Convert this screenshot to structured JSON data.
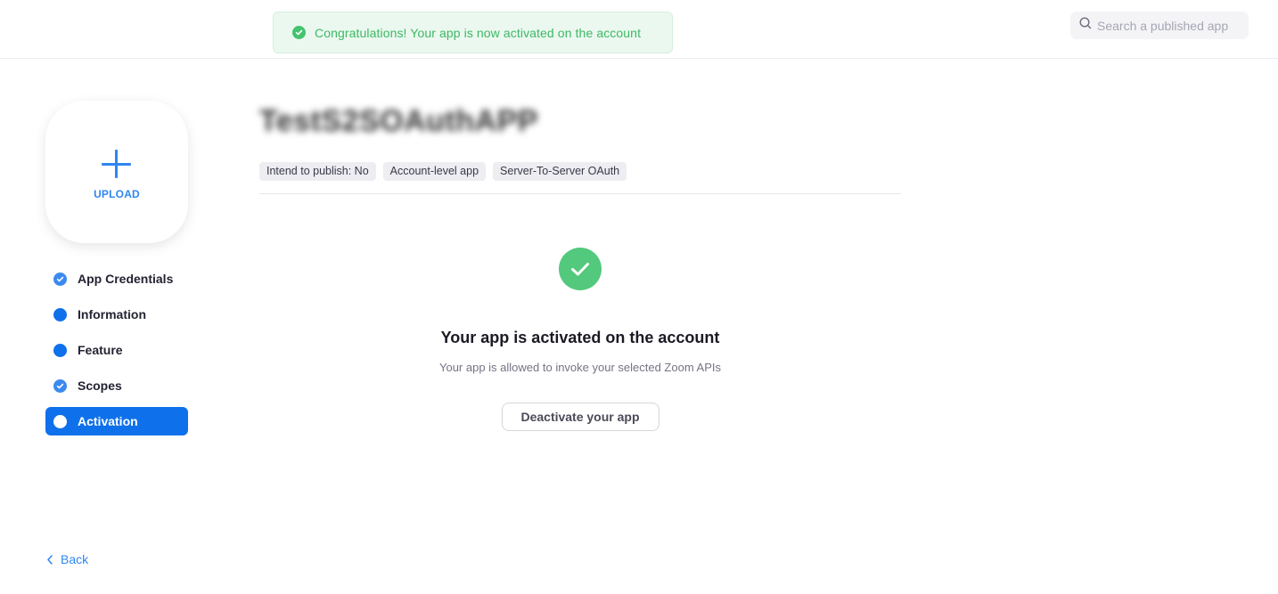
{
  "toast": {
    "message": "Congratulations! Your app is now activated on the account",
    "icon": "check-circle-icon",
    "color": "#3db865"
  },
  "search": {
    "placeholder": "Search a published app",
    "value": "",
    "icon": "search-icon"
  },
  "upload": {
    "label": "UPLOAD",
    "icon": "plus-icon"
  },
  "sidebar": {
    "items": [
      {
        "label": "App Credentials",
        "status": "complete",
        "active": false
      },
      {
        "label": "Information",
        "status": "incomplete",
        "active": false
      },
      {
        "label": "Feature",
        "status": "incomplete",
        "active": false
      },
      {
        "label": "Scopes",
        "status": "complete",
        "active": false
      },
      {
        "label": "Activation",
        "status": "current",
        "active": true
      }
    ],
    "accent": "#0e71eb"
  },
  "back": {
    "label": "Back"
  },
  "app": {
    "title": "TestS2SOAuthAPP",
    "title_blurred": true,
    "tags": [
      "Intend to publish: No",
      "Account-level app",
      "Server-To-Server OAuth"
    ]
  },
  "activation": {
    "heading": "Your app is activated on the account",
    "description": "Your app is allowed to invoke your selected Zoom APIs",
    "button_label": "Deactivate your app",
    "status_color": "#52c97c"
  }
}
